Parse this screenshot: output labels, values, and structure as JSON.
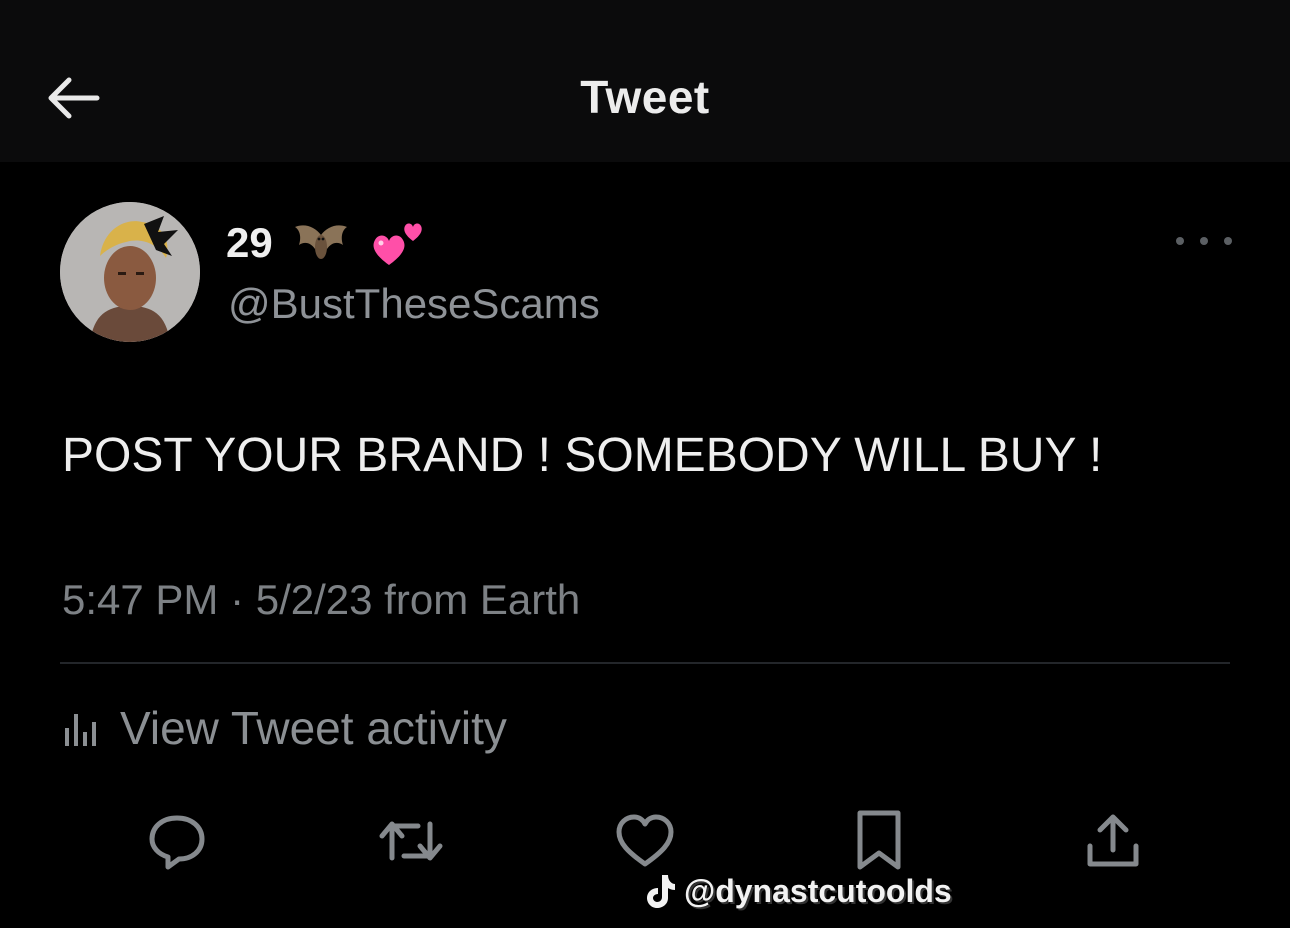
{
  "header": {
    "title": "Tweet",
    "back_icon": "arrow-left-icon"
  },
  "author": {
    "display_name": "29",
    "emojis": [
      "bat-emoji",
      "two-hearts-emoji"
    ],
    "handle": "@BustTheseScams"
  },
  "tweet": {
    "text": "POST YOUR BRAND ! SOMEBODY WILL BUY !",
    "meta": "5:47 PM · 5/2/23 from Earth"
  },
  "activity": {
    "label": "View Tweet activity",
    "icon": "bar-chart-icon"
  },
  "actions": [
    {
      "icon": "reply-icon"
    },
    {
      "icon": "retweet-icon"
    },
    {
      "icon": "like-icon"
    },
    {
      "icon": "bookmark-icon"
    },
    {
      "icon": "share-icon"
    }
  ],
  "watermark": {
    "icon": "tiktok-icon",
    "text": "@dynastcutoolds"
  },
  "colors": {
    "background": "#000000",
    "header_background": "#0b0b0c",
    "primary_text": "#e7e9ea",
    "secondary_text": "#8e9297",
    "heart_pink": "#ff4fa8",
    "divider": "#23262a"
  }
}
